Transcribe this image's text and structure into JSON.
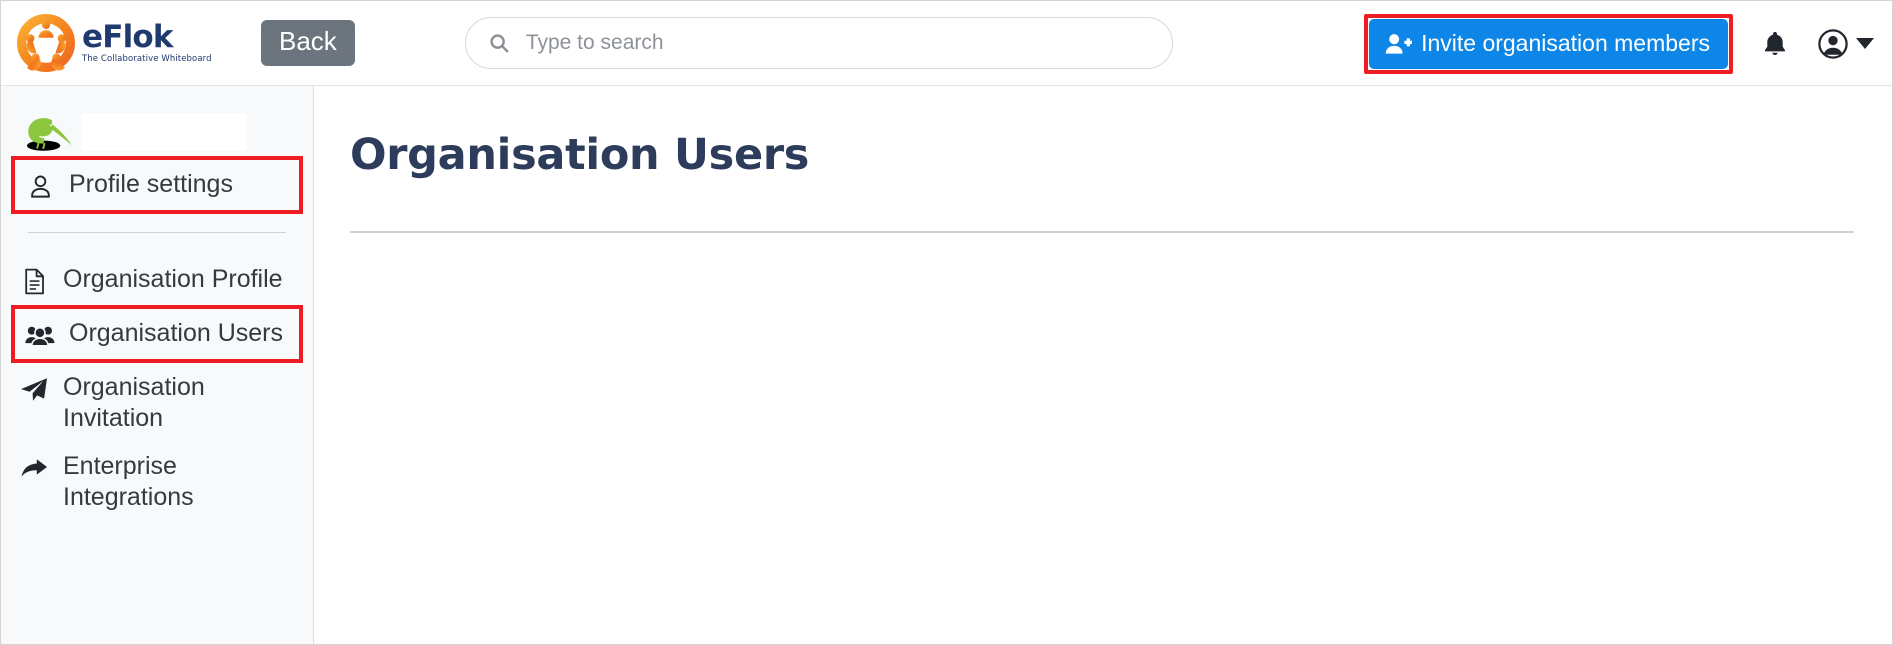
{
  "brand": {
    "name": "eFlok",
    "tagline": "The Collaborative Whiteboard",
    "logo_icon": "flock-circle-logo",
    "colors": {
      "wordmark": "#1f3a6e",
      "logo_orange": "#f2791e",
      "logo_yellow": "#fbb034"
    }
  },
  "header": {
    "back_label": "Back",
    "back_color": "#6c757d",
    "search": {
      "placeholder": "Type to search",
      "value": "",
      "icon": "search-icon"
    },
    "invite": {
      "label": "Invite organisation members",
      "icon": "user-plus-icon",
      "color": "#0d86e8",
      "highlighted": true,
      "highlight_color": "#ee1c25"
    },
    "notifications_icon": "bell-icon",
    "account_icon": "account-circle-icon",
    "account_caret_icon": "chevron-down-icon"
  },
  "sidebar": {
    "org_avatar_icon": "kiwi-bird-avatar",
    "org_name": "",
    "profile_settings": {
      "label": "Profile settings",
      "icon": "person-outline-icon",
      "highlighted": true,
      "highlight_color": "#ee1c25"
    },
    "items": [
      {
        "label": "Organisation Profile",
        "icon": "document-icon",
        "highlighted": false
      },
      {
        "label": "Organisation Users",
        "icon": "users-group-icon",
        "highlighted": true
      },
      {
        "label": "Organisation Invitation",
        "icon": "paper-plane-icon",
        "highlighted": false
      },
      {
        "label": "Enterprise Integrations",
        "icon": "share-arrow-icon",
        "highlighted": false
      }
    ]
  },
  "main": {
    "title": "Organisation Users",
    "title_color": "#2d3c5b"
  }
}
